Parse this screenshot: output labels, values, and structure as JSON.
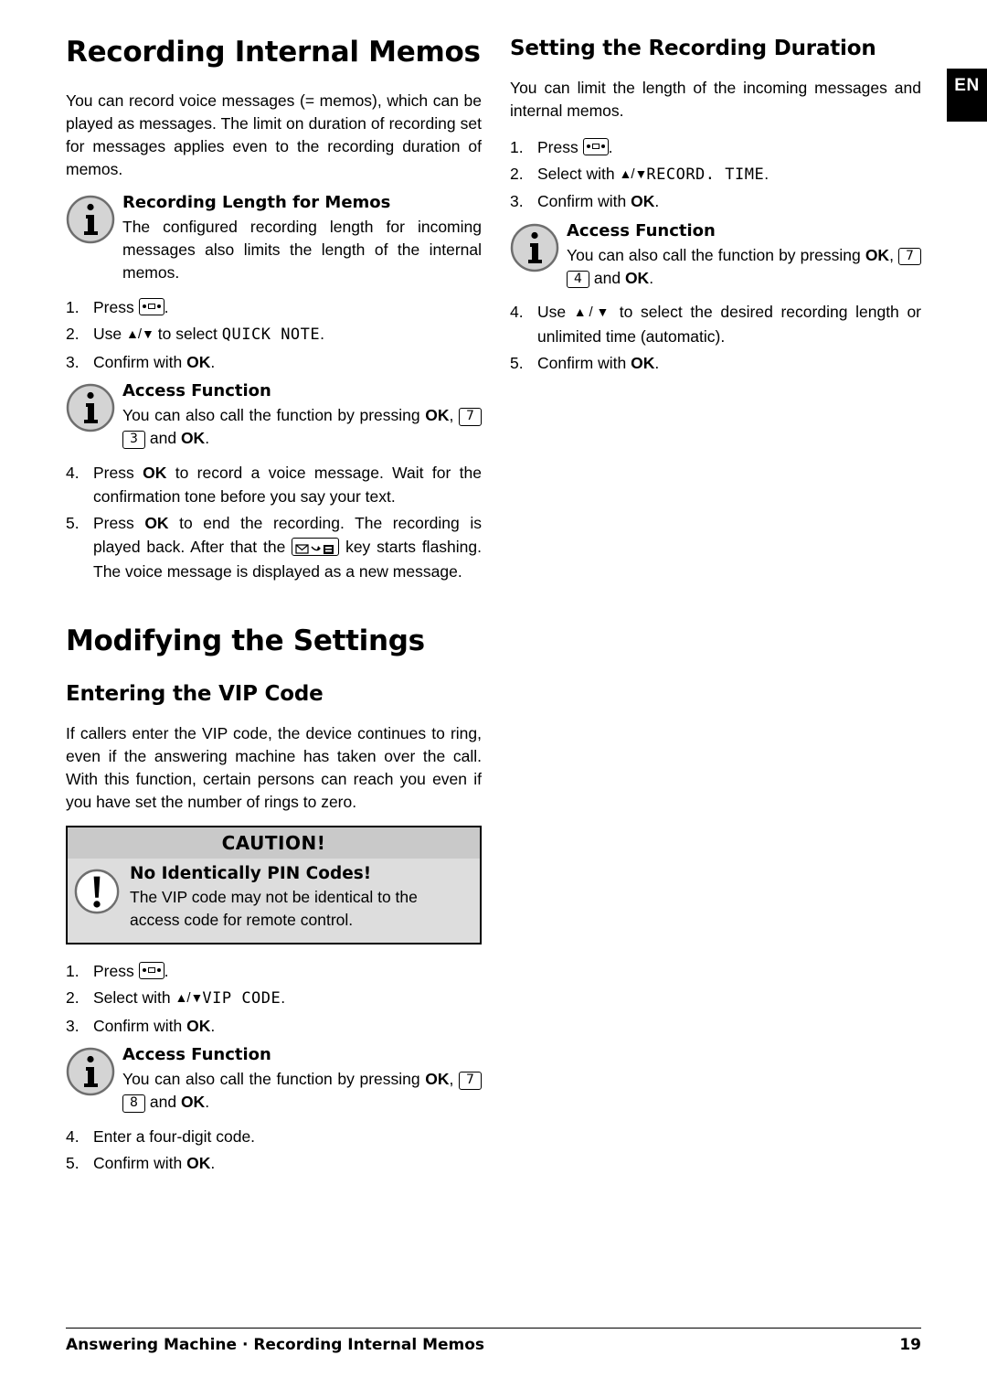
{
  "language_tab": "EN",
  "left": {
    "h1_title": "Recording Internal Memos",
    "intro": "You can record voice messages (= memos), which can be played as messages. The limit on duration of recording set for messages applies even to the recording duration of memos.",
    "note_memos": {
      "icon": "info-icon",
      "title": "Recording Length for Memos",
      "text": "The configured recording length for incoming messages also limits the length of the internal memos."
    },
    "steps_quicknote": [
      {
        "num": "1.",
        "pre": "Press ",
        "key": "answering-machine-key",
        "post": "."
      },
      {
        "num": "2.",
        "pre": "Use ",
        "arrows": "▲/▼",
        "mid": " to select ",
        "mono": "QUICK NOTE",
        "post": "."
      },
      {
        "num": "3.",
        "pre": "Confirm with ",
        "bold": "OK",
        "post": "."
      }
    ],
    "note_access_1": {
      "icon": "info-icon",
      "title": "Access Function",
      "text_pre": "You can also call the function by pressing ",
      "ok1": "OK",
      "comma": ", ",
      "key1": "7",
      "key2": "3",
      "text_mid": " and ",
      "ok2": "OK",
      "text_end": "."
    },
    "steps_record": [
      {
        "num": "4.",
        "pre": "Press ",
        "bold": "OK",
        "post": " to record a voice message. Wait for the confirmation tone before you say your text."
      },
      {
        "num": "5.",
        "pre": "Press ",
        "bold": "OK",
        "mid": " to end the recording. The recording is played back. After that the ",
        "key": "message-key",
        "post": " key starts flashing. The voice message is displayed as a new message."
      }
    ],
    "h1_modify": "Modifying the Settings",
    "h2_vip": "Entering the VIP Code",
    "vip_intro": "If callers enter the VIP code, the device continues to ring, even if the answering machine has taken over the call. With this function, certain persons can reach you even if you have set the number of rings to zero.",
    "caution": {
      "header": "CAUTION!",
      "icon": "exclamation-icon",
      "title": "No Identically PIN Codes!",
      "text": "The VIP code may not be identical to the access code for remote control."
    },
    "steps_vip": [
      {
        "num": "1.",
        "pre": "Press ",
        "key": "answering-machine-key",
        "post": "."
      },
      {
        "num": "2.",
        "pre": "Select with ",
        "arrows": "▲/▼",
        "mono": "VIP CODE",
        "post": "."
      },
      {
        "num": "3.",
        "pre": "Confirm with ",
        "bold": "OK",
        "post": "."
      }
    ],
    "note_access_2": {
      "icon": "info-icon",
      "title": "Access Function",
      "text_pre": "You can also call the function by pressing ",
      "ok1": "OK",
      "comma": ", ",
      "key1": "7",
      "key2": "8",
      "text_mid": " and ",
      "ok2": "OK",
      "text_end": "."
    },
    "steps_vip_end": [
      {
        "num": "4.",
        "pre": "Enter a four-digit code."
      },
      {
        "num": "5.",
        "pre": "Confirm with ",
        "bold": "OK",
        "post": "."
      }
    ]
  },
  "right": {
    "h2_title": "Setting the Recording Duration",
    "intro": "You can limit the length of the incoming messages and internal memos.",
    "steps_top": [
      {
        "num": "1.",
        "pre": "Press ",
        "key": "answering-machine-key",
        "post": "."
      },
      {
        "num": "2.",
        "pre": "Select with ",
        "arrows": "▲/▼",
        "mono": "RECORD. TIME",
        "post": "."
      },
      {
        "num": "3.",
        "pre": "Confirm with ",
        "bold": "OK",
        "post": "."
      }
    ],
    "note_access": {
      "icon": "info-icon",
      "title": "Access Function",
      "text_pre": "You can also call the function by pressing ",
      "ok1": "OK",
      "comma": ", ",
      "key1": "7",
      "key2": "4",
      "text_mid": " and ",
      "ok2": "OK",
      "text_end": "."
    },
    "steps_bottom": [
      {
        "num": "4.",
        "pre": "Use ",
        "arrows": "▲/▼",
        "post": " to select the desired recording length or unlimited time (automatic)."
      },
      {
        "num": "5.",
        "pre": "Confirm with ",
        "bold": "OK",
        "post": "."
      }
    ]
  },
  "footer": {
    "left": "Answering Machine · Recording Internal Memos",
    "page": "19"
  }
}
